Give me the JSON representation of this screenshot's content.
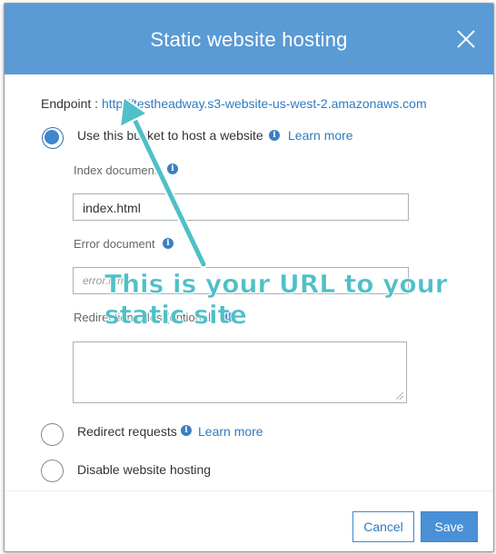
{
  "dialog": {
    "title": "Static website hosting",
    "close_icon": "close-icon"
  },
  "endpoint": {
    "label": "Endpoint :",
    "url": "http://testheadway.s3-website-us-west-2.amazonaws.com"
  },
  "options": {
    "host": {
      "label": "Use this bucket to host a website",
      "learn_more": "Learn more",
      "selected": true
    },
    "redirect": {
      "label": "Redirect requests",
      "learn_more": "Learn more",
      "selected": false
    },
    "disable": {
      "label": "Disable website hosting",
      "selected": false
    }
  },
  "fields": {
    "index": {
      "label": "Index document",
      "value": "index.html"
    },
    "error": {
      "label": "Error document",
      "placeholder": "error.html"
    },
    "redirection": {
      "label": "Redirection rules (optional)",
      "value": ""
    }
  },
  "annotation": {
    "line1": "This is your URL to your",
    "line2": "static site",
    "color": "#4fc0c7"
  },
  "buttons": {
    "cancel": "Cancel",
    "save": "Save"
  },
  "colors": {
    "header": "#5a9ad5",
    "link": "#2f7bbf",
    "primary": "#4a90d6"
  }
}
